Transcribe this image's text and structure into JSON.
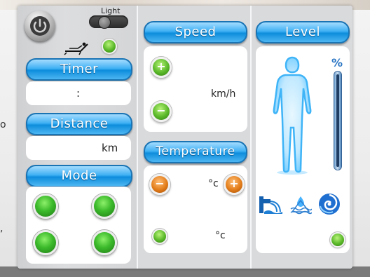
{
  "background": {
    "left_glyph_1": "o",
    "left_glyph_2": ","
  },
  "controls": {
    "light_label": "Light",
    "power_icon": "power-icon",
    "person_icon": "reclining-person-icon"
  },
  "timer": {
    "label": "Timer",
    "value": ":"
  },
  "distance": {
    "label": "Distance",
    "unit": "km"
  },
  "mode": {
    "label": "Mode"
  },
  "speed": {
    "label": "Speed",
    "unit": "km/h"
  },
  "temperature": {
    "label": "Temperature",
    "unit_1": "°c",
    "unit_2": "°c"
  },
  "level": {
    "label": "Level",
    "percent_sign": "%"
  },
  "colors": {
    "accent": "#2aa3ee",
    "green": "#4fbf2e",
    "orange": "#e07a1a"
  }
}
